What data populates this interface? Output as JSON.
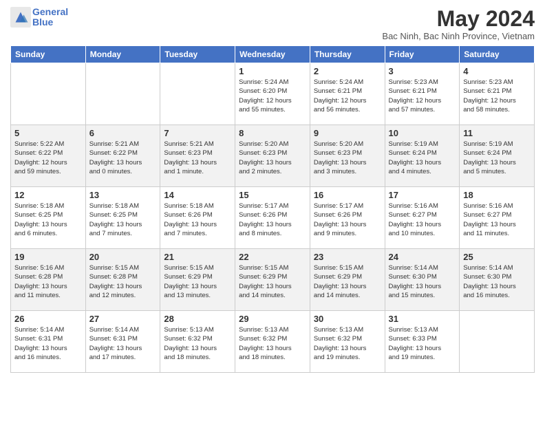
{
  "header": {
    "logo_line1": "General",
    "logo_line2": "Blue",
    "title": "May 2024",
    "subtitle": "Bac Ninh, Bac Ninh Province, Vietnam"
  },
  "weekdays": [
    "Sunday",
    "Monday",
    "Tuesday",
    "Wednesday",
    "Thursday",
    "Friday",
    "Saturday"
  ],
  "weeks": [
    [
      {
        "day": "",
        "info": ""
      },
      {
        "day": "",
        "info": ""
      },
      {
        "day": "",
        "info": ""
      },
      {
        "day": "1",
        "info": "Sunrise: 5:24 AM\nSunset: 6:20 PM\nDaylight: 12 hours\nand 55 minutes."
      },
      {
        "day": "2",
        "info": "Sunrise: 5:24 AM\nSunset: 6:21 PM\nDaylight: 12 hours\nand 56 minutes."
      },
      {
        "day": "3",
        "info": "Sunrise: 5:23 AM\nSunset: 6:21 PM\nDaylight: 12 hours\nand 57 minutes."
      },
      {
        "day": "4",
        "info": "Sunrise: 5:23 AM\nSunset: 6:21 PM\nDaylight: 12 hours\nand 58 minutes."
      }
    ],
    [
      {
        "day": "5",
        "info": "Sunrise: 5:22 AM\nSunset: 6:22 PM\nDaylight: 12 hours\nand 59 minutes."
      },
      {
        "day": "6",
        "info": "Sunrise: 5:21 AM\nSunset: 6:22 PM\nDaylight: 13 hours\nand 0 minutes."
      },
      {
        "day": "7",
        "info": "Sunrise: 5:21 AM\nSunset: 6:23 PM\nDaylight: 13 hours\nand 1 minute."
      },
      {
        "day": "8",
        "info": "Sunrise: 5:20 AM\nSunset: 6:23 PM\nDaylight: 13 hours\nand 2 minutes."
      },
      {
        "day": "9",
        "info": "Sunrise: 5:20 AM\nSunset: 6:23 PM\nDaylight: 13 hours\nand 3 minutes."
      },
      {
        "day": "10",
        "info": "Sunrise: 5:19 AM\nSunset: 6:24 PM\nDaylight: 13 hours\nand 4 minutes."
      },
      {
        "day": "11",
        "info": "Sunrise: 5:19 AM\nSunset: 6:24 PM\nDaylight: 13 hours\nand 5 minutes."
      }
    ],
    [
      {
        "day": "12",
        "info": "Sunrise: 5:18 AM\nSunset: 6:25 PM\nDaylight: 13 hours\nand 6 minutes."
      },
      {
        "day": "13",
        "info": "Sunrise: 5:18 AM\nSunset: 6:25 PM\nDaylight: 13 hours\nand 7 minutes."
      },
      {
        "day": "14",
        "info": "Sunrise: 5:18 AM\nSunset: 6:26 PM\nDaylight: 13 hours\nand 7 minutes."
      },
      {
        "day": "15",
        "info": "Sunrise: 5:17 AM\nSunset: 6:26 PM\nDaylight: 13 hours\nand 8 minutes."
      },
      {
        "day": "16",
        "info": "Sunrise: 5:17 AM\nSunset: 6:26 PM\nDaylight: 13 hours\nand 9 minutes."
      },
      {
        "day": "17",
        "info": "Sunrise: 5:16 AM\nSunset: 6:27 PM\nDaylight: 13 hours\nand 10 minutes."
      },
      {
        "day": "18",
        "info": "Sunrise: 5:16 AM\nSunset: 6:27 PM\nDaylight: 13 hours\nand 11 minutes."
      }
    ],
    [
      {
        "day": "19",
        "info": "Sunrise: 5:16 AM\nSunset: 6:28 PM\nDaylight: 13 hours\nand 11 minutes."
      },
      {
        "day": "20",
        "info": "Sunrise: 5:15 AM\nSunset: 6:28 PM\nDaylight: 13 hours\nand 12 minutes."
      },
      {
        "day": "21",
        "info": "Sunrise: 5:15 AM\nSunset: 6:29 PM\nDaylight: 13 hours\nand 13 minutes."
      },
      {
        "day": "22",
        "info": "Sunrise: 5:15 AM\nSunset: 6:29 PM\nDaylight: 13 hours\nand 14 minutes."
      },
      {
        "day": "23",
        "info": "Sunrise: 5:15 AM\nSunset: 6:29 PM\nDaylight: 13 hours\nand 14 minutes."
      },
      {
        "day": "24",
        "info": "Sunrise: 5:14 AM\nSunset: 6:30 PM\nDaylight: 13 hours\nand 15 minutes."
      },
      {
        "day": "25",
        "info": "Sunrise: 5:14 AM\nSunset: 6:30 PM\nDaylight: 13 hours\nand 16 minutes."
      }
    ],
    [
      {
        "day": "26",
        "info": "Sunrise: 5:14 AM\nSunset: 6:31 PM\nDaylight: 13 hours\nand 16 minutes."
      },
      {
        "day": "27",
        "info": "Sunrise: 5:14 AM\nSunset: 6:31 PM\nDaylight: 13 hours\nand 17 minutes."
      },
      {
        "day": "28",
        "info": "Sunrise: 5:13 AM\nSunset: 6:32 PM\nDaylight: 13 hours\nand 18 minutes."
      },
      {
        "day": "29",
        "info": "Sunrise: 5:13 AM\nSunset: 6:32 PM\nDaylight: 13 hours\nand 18 minutes."
      },
      {
        "day": "30",
        "info": "Sunrise: 5:13 AM\nSunset: 6:32 PM\nDaylight: 13 hours\nand 19 minutes."
      },
      {
        "day": "31",
        "info": "Sunrise: 5:13 AM\nSunset: 6:33 PM\nDaylight: 13 hours\nand 19 minutes."
      },
      {
        "day": "",
        "info": ""
      }
    ]
  ]
}
